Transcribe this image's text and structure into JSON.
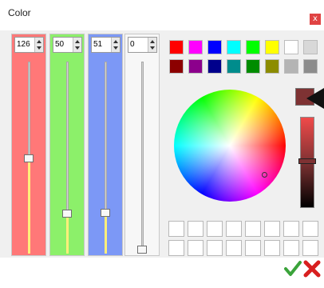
{
  "window": {
    "title": "Color",
    "close_label": "x"
  },
  "channels": {
    "red": {
      "value": "126",
      "fraction": 0.494
    },
    "green": {
      "value": "50",
      "fraction": 0.196
    },
    "blue": {
      "value": "51",
      "fraction": 0.2
    },
    "alpha": {
      "value": "0",
      "fraction": 0.0
    }
  },
  "palette": {
    "row1": [
      "#ff0000",
      "#ff00ff",
      "#0000ff",
      "#00ffff",
      "#00ff00",
      "#ffff00",
      "#ffffff",
      "#d8d8d8"
    ],
    "row2": [
      "#8c0000",
      "#8c008c",
      "#00008c",
      "#008c8c",
      "#008c00",
      "#8c8c00",
      "#b4b4b4",
      "#8c8c8c"
    ]
  },
  "current_color": "#7e3233",
  "icons": {
    "ok": "green-check-icon",
    "cancel": "red-x-icon",
    "pointer": "black-arrow-pointer-icon"
  }
}
